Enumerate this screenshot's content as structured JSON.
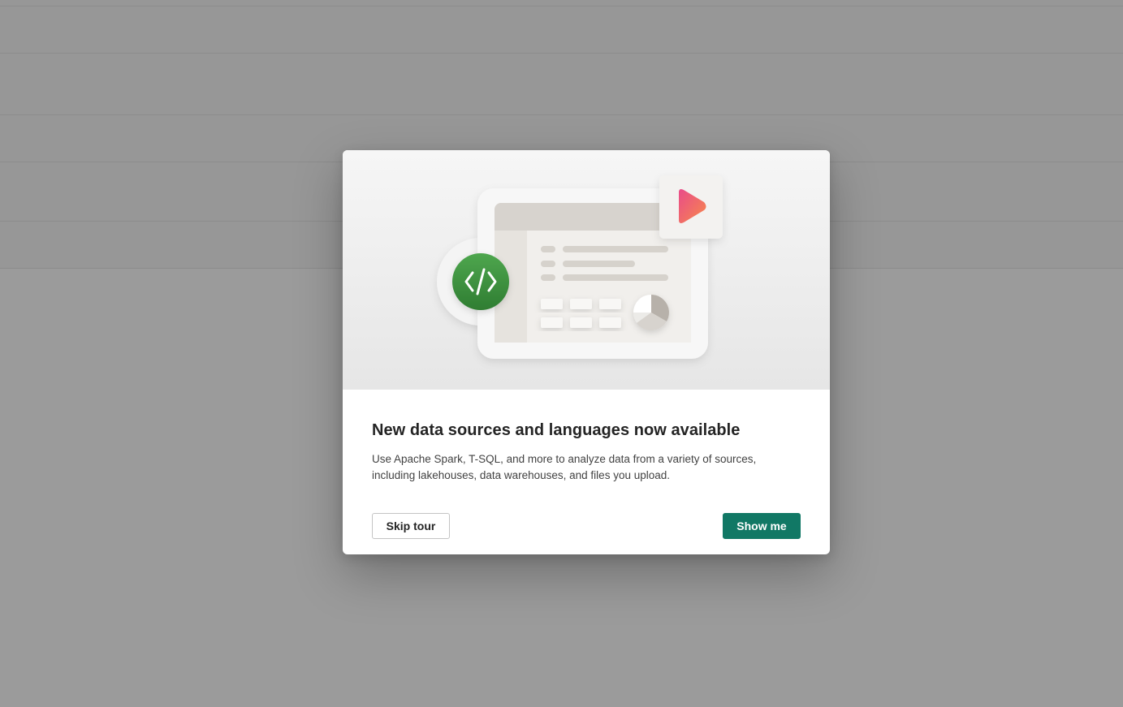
{
  "dialog": {
    "title": "New data sources and languages now available",
    "description": "Use Apache Spark, T-SQL, and more to analyze data from a variety of sources, including lakehouses, data warehouses, and files you upload.",
    "skip_label": "Skip tour",
    "show_label": "Show me",
    "hero_icons": [
      "code-icon",
      "play-icon",
      "pie-chart-icon"
    ],
    "colors": {
      "primary_button": "#117865",
      "code_badge": "#3d9140",
      "play_gradient_start": "#f5475e",
      "play_gradient_end": "#f58a4a",
      "overlay": "#9b9b9b"
    }
  }
}
